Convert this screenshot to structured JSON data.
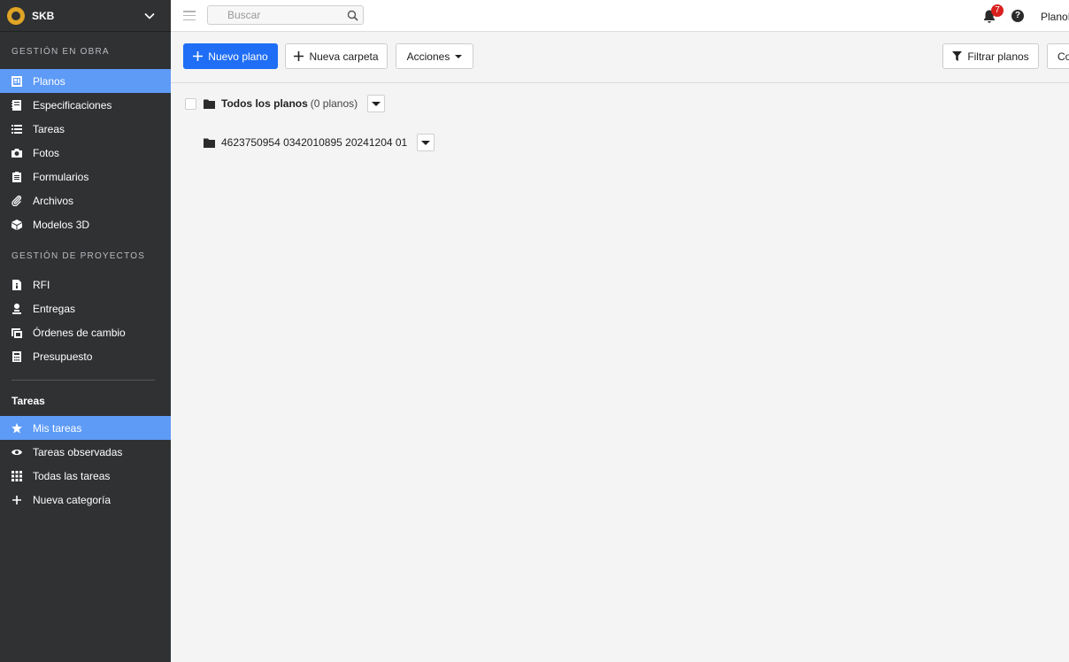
{
  "org": {
    "name": "SKB"
  },
  "sidebar": {
    "section_obra": "GESTIÓN EN OBRA",
    "obra_items": [
      {
        "label": "Planos",
        "icon": "drawing-icon",
        "active": true
      },
      {
        "label": "Especificaciones",
        "icon": "book-icon"
      },
      {
        "label": "Tareas",
        "icon": "list-icon"
      },
      {
        "label": "Fotos",
        "icon": "camera-icon"
      },
      {
        "label": "Formularios",
        "icon": "clipboard-icon"
      },
      {
        "label": "Archivos",
        "icon": "paperclip-icon"
      },
      {
        "label": "Modelos 3D",
        "icon": "cube-icon"
      }
    ],
    "section_proyectos": "GESTIÓN DE PROYECTOS",
    "proyecto_items": [
      {
        "label": "RFI",
        "icon": "info-file-icon"
      },
      {
        "label": "Entregas",
        "icon": "user-stamp-icon"
      },
      {
        "label": "Órdenes de cambio",
        "icon": "change-order-icon"
      },
      {
        "label": "Presupuesto",
        "icon": "calculator-icon"
      }
    ],
    "tasks_title": "Tareas",
    "task_items": [
      {
        "label": "Mis tareas",
        "icon": "star-icon",
        "active": true
      },
      {
        "label": "Tareas observadas",
        "icon": "eye-icon"
      },
      {
        "label": "Todas las tareas",
        "icon": "grid-icon"
      },
      {
        "label": "Nueva categoría",
        "icon": "plus-icon"
      }
    ]
  },
  "topbar": {
    "search_placeholder": "Buscar",
    "notification_count": "7",
    "help_label": "?",
    "user_name": "PlanoB"
  },
  "toolbar": {
    "new_plan": "Nuevo plano",
    "new_folder": "Nueva carpeta",
    "actions": "Acciones",
    "filter": "Filtrar planos",
    "more": "Co"
  },
  "tree": {
    "root_label": "Todos los planos",
    "root_count": "(0 planos)",
    "child_label": "4623750954 0342010895 20241204 01"
  },
  "colors": {
    "sidebar_bg": "#2f3133",
    "active": "#5e9bf7",
    "primary": "#1f6ef5",
    "badge": "#d9201e"
  }
}
